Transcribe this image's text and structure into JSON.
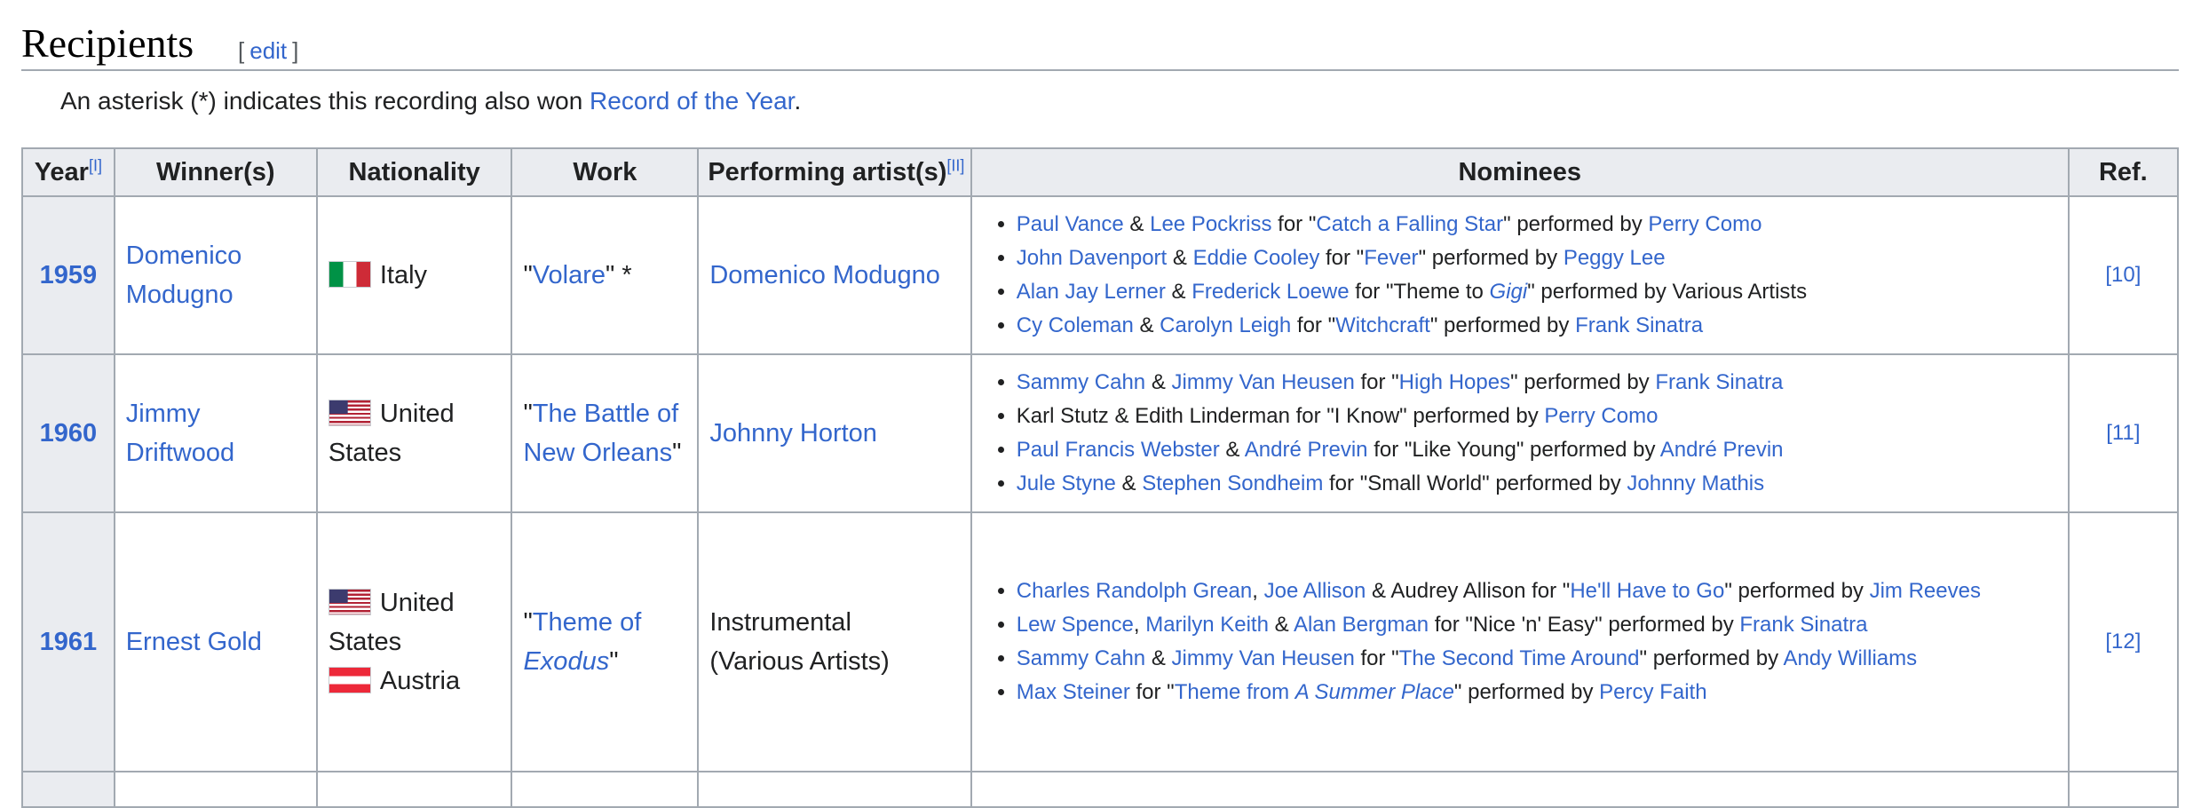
{
  "section": {
    "title": "Recipients",
    "edit_label": "edit",
    "bracket_open": "[",
    "bracket_close": "]"
  },
  "note": {
    "text": "An asterisk (*) indicates this recording also won ",
    "link": "Record of the Year",
    "end": "."
  },
  "columns": {
    "year": "Year",
    "year_note": "[I]",
    "winners": "Winner(s)",
    "nationality": "Nationality",
    "work": "Work",
    "performers": "Performing artist(s)",
    "performers_note": "[II]",
    "nominees": "Nominees",
    "ref": "Ref."
  },
  "rows": [
    {
      "year": "1959",
      "winner": "Domenico Modugno",
      "nationality": [
        {
          "country": "Italy",
          "flag": "flag-italy"
        }
      ],
      "work": {
        "open": "\"",
        "title": "Volare",
        "close": "\" *"
      },
      "performer": "Domenico Modugno",
      "ref": "[10]",
      "nominees": [
        {
          "a": "Paul Vance",
          "and": " & ",
          "b": "Lee Pockriss",
          "for": " for \"",
          "song": "Catch a Falling Star",
          "by": "\" performed by ",
          "artist": "Perry Como"
        },
        {
          "a": "John Davenport",
          "and": " & ",
          "b": "Eddie Cooley",
          "for": " for \"",
          "song": "Fever",
          "by": "\" performed by ",
          "artist": "Peggy Lee"
        },
        {
          "a": "Alan Jay Lerner",
          "and": " & ",
          "b": "Frederick Loewe",
          "for": " for \"Theme to ",
          "film": "Gigi",
          "by": "\" performed by Various Artists"
        },
        {
          "a": "Cy Coleman",
          "and": " & ",
          "b": "Carolyn Leigh",
          "for": " for \"",
          "song": "Witchcraft",
          "by": "\" performed by ",
          "artist": "Frank Sinatra"
        }
      ]
    },
    {
      "year": "1960",
      "winner": "Jimmy Driftwood",
      "nationality": [
        {
          "country": "United States",
          "flag": "flag-usa"
        }
      ],
      "work": {
        "open": "\"",
        "title": "The Battle of New Orleans",
        "close": "\""
      },
      "performer": "Johnny Horton",
      "ref": "[11]",
      "nominees": [
        {
          "a": "Sammy Cahn",
          "and": " & ",
          "b": "Jimmy Van Heusen",
          "for": " for \"",
          "song": "High Hopes",
          "by": "\" performed by ",
          "artist": "Frank Sinatra"
        },
        {
          "plain": "Karl Stutz & Edith Linderman for \"I Know\" performed by ",
          "artist": "Perry Como"
        },
        {
          "a": "Paul Francis Webster",
          "and": " & ",
          "b": "André Previn",
          "for": " for \"Like Young\" performed by ",
          "artist": "André Previn"
        },
        {
          "a": "Jule Styne",
          "and": " & ",
          "b": "Stephen Sondheim",
          "for": " for \"Small World\" performed by ",
          "artist": "Johnny Mathis"
        }
      ]
    },
    {
      "year": "1961",
      "winner": "Ernest Gold",
      "nationality": [
        {
          "country": "United States",
          "flag": "flag-usa"
        },
        {
          "country": "Austria",
          "flag": "flag-austria"
        }
      ],
      "work": {
        "open": "\"",
        "title": "Theme of ",
        "title_italic": "Exodus",
        "close": "\""
      },
      "performer_line1": "Instrumental",
      "performer_line2": "(Various Artists)",
      "ref": "[12]",
      "nominees": [
        {
          "a": "Charles Randolph Grean",
          "sep": ", ",
          "b": "Joe Allison",
          "c": " & Audrey Allison for \"",
          "song": "He'll Have to Go",
          "by": "\" performed by ",
          "artist": "Jim Reeves"
        },
        {
          "a": "Lew Spence",
          "sep": ", ",
          "b": "Marilyn Keith",
          "and": " & ",
          "c": "Alan Bergman",
          "for": " for \"Nice 'n' Easy\" performed by ",
          "artist": "Frank Sinatra"
        },
        {
          "a": "Sammy Cahn",
          "and": " & ",
          "b": "Jimmy Van Heusen",
          "for": " for \"",
          "song": "The Second Time Around",
          "by": "\" performed by ",
          "artist": "Andy Williams"
        },
        {
          "a": "Max Steiner",
          "for": " for \"",
          "song": "Theme from ",
          "song_italic": "A Summer Place",
          "by": "\" performed by ",
          "artist": "Percy Faith"
        }
      ]
    }
  ]
}
